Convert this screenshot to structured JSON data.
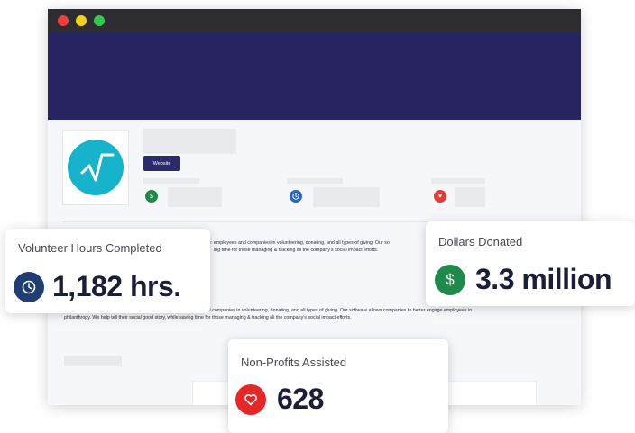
{
  "window": {
    "buttons": [
      "close",
      "minimize",
      "maximize"
    ]
  },
  "profile": {
    "website_button": "Website",
    "icons": [
      "dollar-icon",
      "clock-icon",
      "heart-icon"
    ],
    "about_line1_a": "e: employees and companies in volunteering, donating, and all types of giving. Our so",
    "about_line1_b": "ing time for those managing & tracking all the company's social impact efforts.",
    "about_line2_a": "Goodly is a Boise, Idaho-based startup. We empower employees and companies in volunteering, donating, and all types of giving. Our software allows companies to better engage employees in",
    "about_line2_b": "philanthropy. We help tell their social good story, while saving time for those managing & tracking all the company's social impact efforts."
  },
  "stats": {
    "volunteer": {
      "label": "Volunteer Hours Completed",
      "value": "1,182 hrs.",
      "icon": "clock-icon",
      "color": "#1f3e74"
    },
    "donated": {
      "label": "Dollars Donated",
      "value": "3.3 million",
      "icon": "dollar-icon",
      "color": "#1f8a4c"
    },
    "nonprofits": {
      "label": "Non-Profits Assisted",
      "value": "628",
      "icon": "heart-icon",
      "color": "#e52727"
    }
  }
}
